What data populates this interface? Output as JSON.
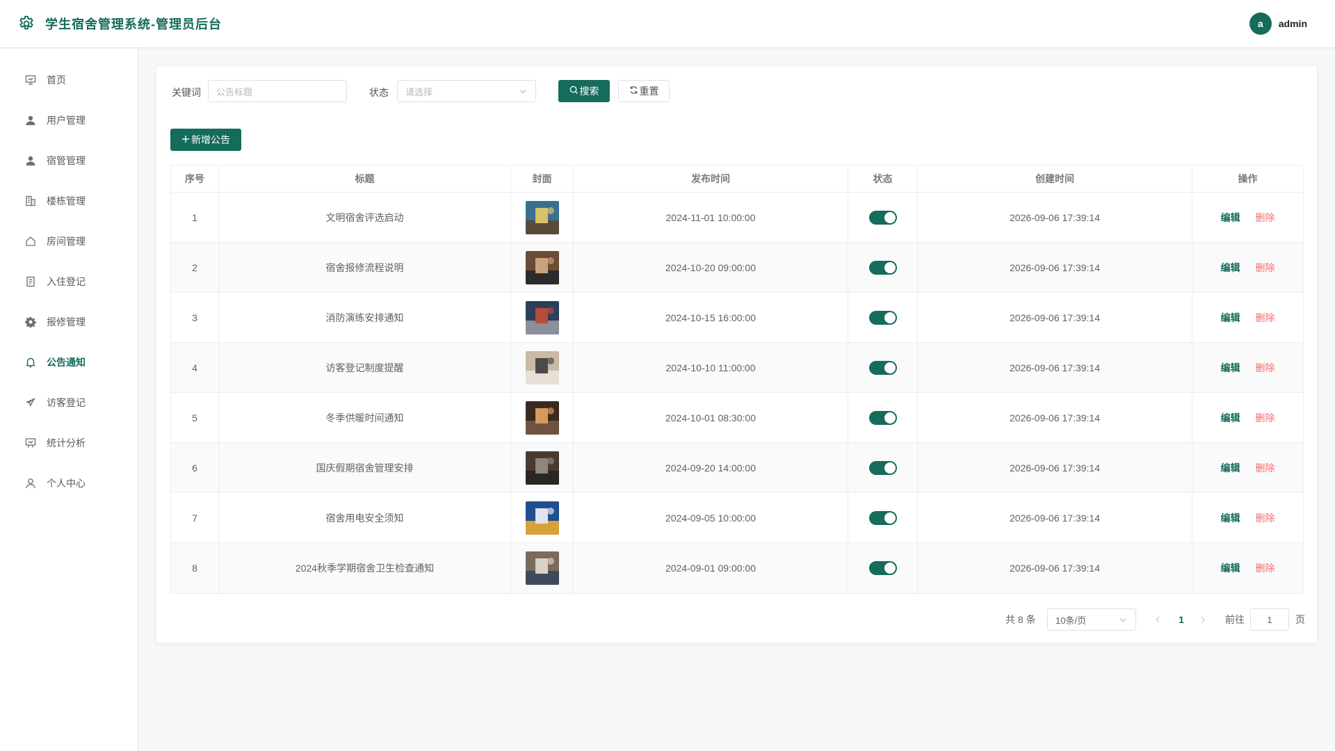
{
  "app": {
    "title": "学生宿舍管理系统-管理员后台",
    "user_initial": "a",
    "username": "admin"
  },
  "sidebar": {
    "items": [
      {
        "label": "首页",
        "icon": "dashboard-icon",
        "active": false
      },
      {
        "label": "用户管理",
        "icon": "user-icon",
        "active": false
      },
      {
        "label": "宿管管理",
        "icon": "user-icon",
        "active": false
      },
      {
        "label": "楼栋管理",
        "icon": "building-icon",
        "active": false
      },
      {
        "label": "房间管理",
        "icon": "house-icon",
        "active": false
      },
      {
        "label": "入住登记",
        "icon": "document-icon",
        "active": false
      },
      {
        "label": "报修管理",
        "icon": "gear-icon",
        "active": false
      },
      {
        "label": "公告通知",
        "icon": "bell-icon",
        "active": true
      },
      {
        "label": "访客登记",
        "icon": "send-icon",
        "active": false
      },
      {
        "label": "统计分析",
        "icon": "chart-board-icon",
        "active": false
      },
      {
        "label": "个人中心",
        "icon": "person-icon",
        "active": false
      }
    ]
  },
  "filters": {
    "keyword_label": "关键词",
    "keyword_placeholder": "公告标题",
    "status_label": "状态",
    "status_placeholder": "请选择",
    "search_label": "搜索",
    "reset_label": "重置",
    "add_label": "新增公告"
  },
  "table": {
    "headers": [
      "序号",
      "标题",
      "封面",
      "发布时间",
      "状态",
      "创建时间",
      "操作"
    ],
    "edit_label": "编辑",
    "delete_label": "删除",
    "rows": [
      {
        "index": "1",
        "title": "文明宿舍评选启动",
        "publish_time": "2024-11-01 10:00:00",
        "status_on": true,
        "created_time": "2026-09-06 17:39:14"
      },
      {
        "index": "2",
        "title": "宿舍报修流程说明",
        "publish_time": "2024-10-20 09:00:00",
        "status_on": true,
        "created_time": "2026-09-06 17:39:14"
      },
      {
        "index": "3",
        "title": "消防演练安排通知",
        "publish_time": "2024-10-15 16:00:00",
        "status_on": true,
        "created_time": "2026-09-06 17:39:14"
      },
      {
        "index": "4",
        "title": "访客登记制度提醒",
        "publish_time": "2024-10-10 11:00:00",
        "status_on": true,
        "created_time": "2026-09-06 17:39:14"
      },
      {
        "index": "5",
        "title": "冬季供暖时间通知",
        "publish_time": "2024-10-01 08:30:00",
        "status_on": true,
        "created_time": "2026-09-06 17:39:14"
      },
      {
        "index": "6",
        "title": "国庆假期宿舍管理安排",
        "publish_time": "2024-09-20 14:00:00",
        "status_on": true,
        "created_time": "2026-09-06 17:39:14"
      },
      {
        "index": "7",
        "title": "宿舍用电安全须知",
        "publish_time": "2024-09-05 10:00:00",
        "status_on": true,
        "created_time": "2026-09-06 17:39:14"
      },
      {
        "index": "8",
        "title": "2024秋季学期宿舍卫生检查通知",
        "publish_time": "2024-09-01 09:00:00",
        "status_on": true,
        "created_time": "2026-09-06 17:39:14"
      }
    ]
  },
  "pagination": {
    "total_label": "共 8 条",
    "page_size": "10条/页",
    "current_page": "1",
    "goto_label": "前往",
    "goto_value": "1",
    "page_suffix": "页"
  },
  "colors": {
    "primary": "#156b5c",
    "danger": "#f56c6c"
  }
}
